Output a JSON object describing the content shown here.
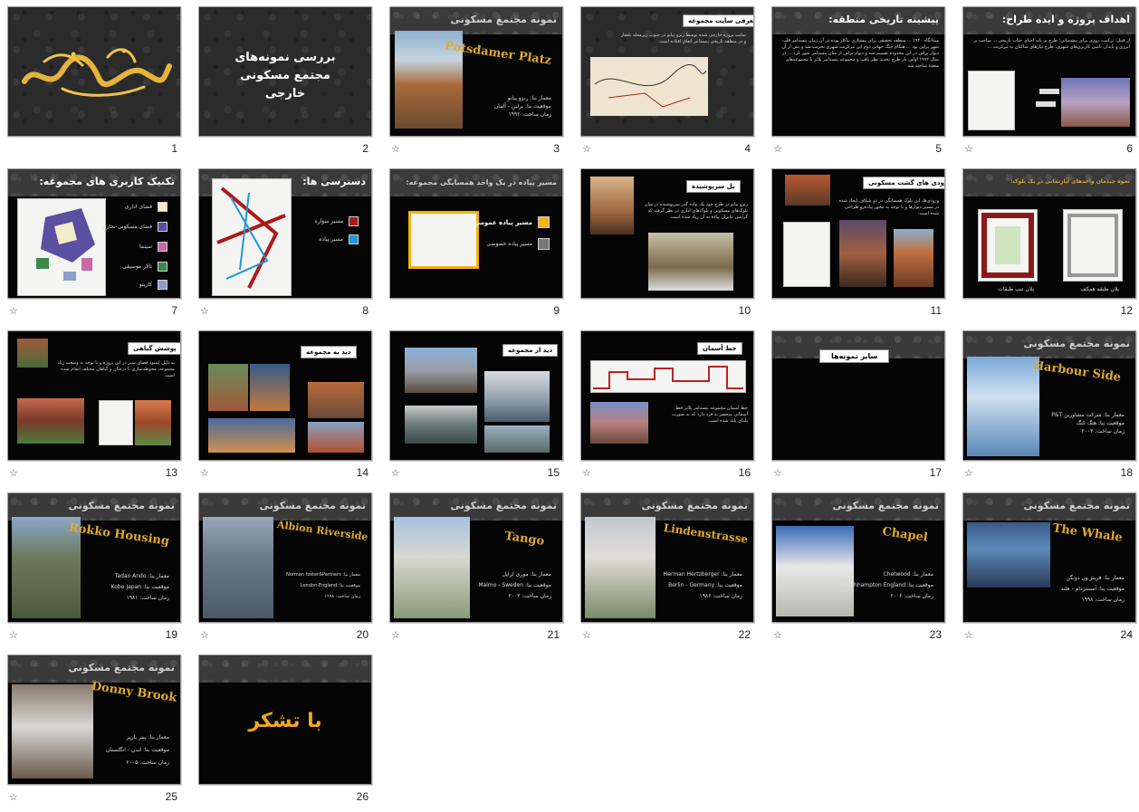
{
  "slides": [
    {
      "num": "1",
      "star": false,
      "calligraphy": "بسم الله الرحمن الرحیم"
    },
    {
      "num": "2",
      "star": false,
      "title": "بررسی نمونه‌های مجتمع مسکونی خارجی"
    },
    {
      "num": "3",
      "star": true,
      "band": "نمونه مجتمع مسکونی",
      "name": "Potsdamer Platz",
      "lines": [
        "معمار بنا: رنزو پیانو",
        "موقعیت بنا: برلین - آلمان",
        "زمان ساخت: ۱۹۹۲"
      ]
    },
    {
      "num": "4",
      "star": true,
      "caption": "معرفی سایت مجموعه",
      "text": "سایت پروژه خارجی شده توسط رنزو پیانو در جنوب زیرمحله بلشار و در منطقه تاریخی پتسدامر اتفاق افتاده است."
    },
    {
      "num": "5",
      "star": true,
      "band": "پیشینه تاریخی منطقه:",
      "text": "میدانگاه ۱۹۲۰ ... منطقه تحقیقی برای پیشتازی بناکار بوده در آن زمان پتسدامر قلب شهر برلین بود ... هنگام جنگ جهانی دوم این مرکزیت شهری تخریب شد و پس از آن دیوار برلین در این محدوده تقسیم شد و دیوار برلین از میان پتسدامر عبور کرد ... در سال ۱۹۹۲ اولین بار طرح تجدید نظر یافت و مجموعه پتسدامر پلاتز با مجموعه‌های متعدد ساخته شد."
    },
    {
      "num": "6",
      "star": true,
      "band": "اهداف پروژه و ایده طراح:",
      "text": "از قبیل: ترکیب، روزی برای پیشتیبانی؛ طرح بر پایه احیای حیات تاریخی ... ساخت پر انرژی و پایدار، تامین کاربری‌های شهری، طرح نیازهای ساکنان به مرکزیت ..."
    },
    {
      "num": "7",
      "star": false,
      "band": "تکنیک کاربری های مجموعه:",
      "legend": [
        {
          "label": "فضای اداری",
          "color": "#f2ecc8"
        },
        {
          "label": "فضای مسکونی-تجاری",
          "color": "#5a4fa0"
        },
        {
          "label": "سینما",
          "color": "#c86aa8"
        },
        {
          "label": "تالار موسیقی",
          "color": "#3a8a4a"
        },
        {
          "label": "کازینو",
          "color": "#8aa0c8"
        }
      ]
    },
    {
      "num": "8",
      "star": false,
      "band": "دسترسی ها:",
      "legend": [
        {
          "label": "مسیر سواره",
          "color": "#b01818"
        },
        {
          "label": "مسیر پیاده",
          "color": "#1a9ad8"
        }
      ]
    },
    {
      "num": "9",
      "star": false,
      "band": "مسیر پیاده در یک واحد همسایگی مجموعه:",
      "legend": [
        {
          "label": "مسیر پیاده عمومی",
          "color": "#f2b40c"
        },
        {
          "label": "مسیر پیاده خصوصی",
          "color": "#777777"
        }
      ]
    },
    {
      "num": "10",
      "star": false,
      "caption": "پل سرپوشیده",
      "text": "رنزو پیانو در طرح خود یک پیاده گذر سرپوشیده در میان بلوک‌های مسکونی و بلوک‌های اداری در نظر گرفته که گرایش عابران پیاده به آن زیاد شده است."
    },
    {
      "num": "11",
      "star": false,
      "caption": "ورودی های گشت مسکونی",
      "text": "ورودی‌ها، این بلوک همسایگی در دو شکاف ایجاد شده در مسیر دیوارها و با توجه به محور پیاده‌رو طراحی شده است."
    },
    {
      "num": "12",
      "star": false,
      "band": "نحوه چیدمان واحدهای آپارتمانی در یک بلوک:",
      "captions": [
        "پلان طبقه همکف",
        "پلان تیپ طبقات"
      ]
    },
    {
      "num": "13",
      "star": true,
      "caption": "پوشش گیاهی",
      "text": "به دلیل کمبود فضای سبز در این پروژه و با توجه به وسعت زیاد مجموعه، محوطه‌سازی با درختان و گیاهان مختلف انجام شده است."
    },
    {
      "num": "14",
      "star": true,
      "caption": "دید به مجموعه"
    },
    {
      "num": "15",
      "star": true,
      "caption": "دید از مجموعه"
    },
    {
      "num": "16",
      "star": true,
      "caption": "خط آسمان",
      "text": "خط آسمان مجموعه پتسدامر پلاتز خط آسمانی منحصر به فرد دارد که به صورت پله‌ای بلند شده است."
    },
    {
      "num": "17",
      "star": true,
      "caption": "سایر نمونه‌ها"
    },
    {
      "num": "18",
      "star": true,
      "band": "نمونه مجتمع مسکونی",
      "name": "Harbour Side",
      "lines": [
        "معمار بنا: شرکت مشاورین P&T",
        "موقعیت بنا: هنگ کنگ",
        "زمان ساخت: ۲۰۰۳"
      ]
    },
    {
      "num": "19",
      "star": true,
      "band": "نمونه مجتمع مسکونی",
      "name": "Rokko Housing",
      "lines": [
        "معمار بنا: Tadao Ando",
        "موقعیت بنا: Kobe Japan",
        "زمان ساخت: ۱۹۸۱"
      ]
    },
    {
      "num": "20",
      "star": true,
      "band": "نمونه مجتمع مسکونی",
      "name": "Albion Riverside",
      "lines": [
        "معمار بنا: Norman foster&Partners",
        "موقعیت بنا: London-England",
        "زمان ساخت: ۱۹۹۸"
      ]
    },
    {
      "num": "21",
      "star": true,
      "band": "نمونه مجتمع مسکونی",
      "name": "Tango",
      "lines": [
        "معمار بنا: موری لرایل",
        "موقعیت بنا: Malmo - Sweden",
        "زمان ساخت: ۲۰۰۳"
      ]
    },
    {
      "num": "22",
      "star": true,
      "band": "نمونه مجتمع مسکونی",
      "name": "Lindenstrasse",
      "lines": [
        "معمار بنا: Herman Hertzberger",
        "موقعیت بنا: Berlin - Germany",
        "زمان ساخت: ۱۹۸۶"
      ]
    },
    {
      "num": "23",
      "star": true,
      "band": "نمونه مجتمع مسکونی",
      "name": "Chapel",
      "lines": [
        "معمار بنا: Chetwood",
        "موقعیت بنا: Southhampton England",
        "زمان ساخت: ۲۰۰۶"
      ]
    },
    {
      "num": "24",
      "star": true,
      "band": "نمونه مجتمع مسکونی",
      "name": "The Whale",
      "lines": [
        "معمار بنا: فریتز ون دونگن",
        "موقعیت بنا: آمستردام - هلند",
        "زمان ساخت: ۱۹۹۸"
      ]
    },
    {
      "num": "25",
      "star": true,
      "band": "نمونه مجتمع مسکونی",
      "name": "Donny Brook",
      "lines": [
        "معمار بنا: پیتر بارپر",
        "موقعیت بنا: لندن - انگلستان",
        "زمان ساخت: ۲۰۰۵"
      ]
    },
    {
      "num": "26",
      "star": false,
      "title": "با تشکر"
    }
  ],
  "icons": {
    "star": "☆"
  },
  "colors": {
    "accent": "#e0a92c",
    "thanks": "#f5a81c",
    "slide_bg": "#050505"
  }
}
